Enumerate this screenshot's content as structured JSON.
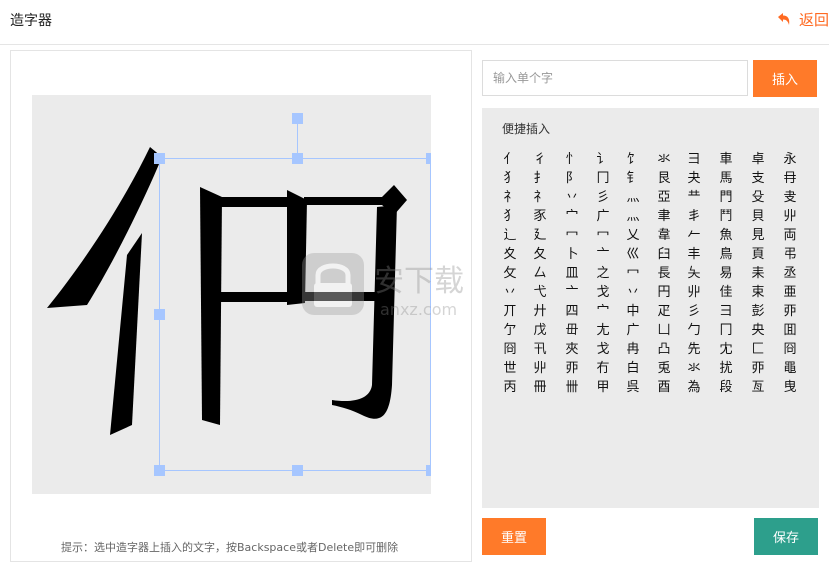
{
  "header": {
    "title": "造字器",
    "back_label": "返回"
  },
  "input": {
    "placeholder": "输入单个字"
  },
  "insert_label": "插入",
  "quick": {
    "title": "便捷插入",
    "columns": [
      [
        "亻",
        "犭",
        "礻",
        "犭",
        "辶",
        "夊",
        "攵",
        "丷",
        "丌",
        "亇",
        "冏",
        "世",
        "丙"
      ],
      [
        "彳",
        "扌",
        "礻",
        "豕",
        "廴",
        "夂",
        "厶",
        "弋",
        "廾",
        "戊",
        "卂",
        "丱",
        "冊"
      ],
      [
        "忄",
        "阝",
        "丷",
        "宀",
        "冖",
        "卜",
        "皿",
        "亠",
        "四",
        "毌",
        "夾",
        "丣",
        "卌"
      ],
      [
        "讠",
        "冂",
        "彡",
        "广",
        "冖",
        "亠",
        "之",
        "戈",
        "宀",
        "尢",
        "戈",
        "冇",
        "甲"
      ],
      [
        "饣",
        "钅",
        "灬",
        "灬",
        "乂",
        "巛",
        "冖",
        "丷",
        "中",
        "广",
        "冉",
        "白",
        "呉"
      ],
      [
        "氺",
        "艮",
        "亞",
        "聿",
        "韋",
        "臼",
        "長",
        "円",
        "疋",
        "凵",
        "凸",
        "兎",
        "酉"
      ],
      [
        "彐",
        "夬",
        "龷",
        "丯",
        "𠂉",
        "丰",
        "夨",
        "丱",
        "彡",
        "勹",
        "先",
        "氺",
        "為"
      ],
      [
        "車",
        "馬",
        "門",
        "鬥",
        "魚",
        "鳥",
        "易",
        "佳",
        "彐",
        "冂",
        "冘",
        "扰",
        "段"
      ],
      [
        "卓",
        "支",
        "殳",
        "貝",
        "見",
        "頁",
        "耒",
        "束",
        "彭",
        "央",
        "匚",
        "丣",
        "亙"
      ],
      [
        "永",
        "冄",
        "叏",
        "丱",
        "両",
        "弔",
        "丞",
        "亜",
        "丣",
        "囬",
        "冏",
        "黽",
        "曳"
      ]
    ]
  },
  "hint": "提示：选中造字器上插入的文字，按Backspace或者Delete即可删除",
  "reset_label": "重置",
  "save_label": "保存",
  "watermark_text": "安下载 anxz.com",
  "colors": {
    "orange": "#ff7a29",
    "teal": "#2d9f8c",
    "canvas_bg": "#ebebeb"
  }
}
